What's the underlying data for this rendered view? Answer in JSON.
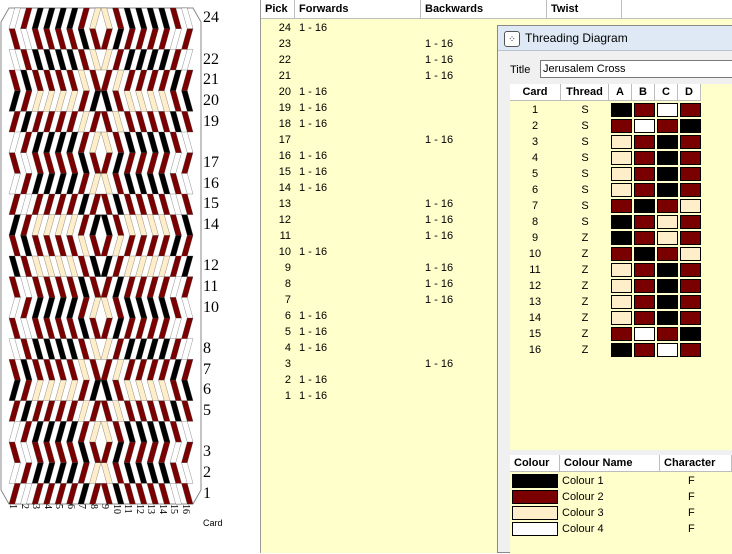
{
  "pattern": {
    "row_labels": [
      "24",
      "22",
      "21",
      "20",
      "19",
      "17",
      "16",
      "15",
      "14",
      "12",
      "11",
      "10",
      "8",
      "7",
      "6",
      "5",
      "3",
      "2",
      "1"
    ],
    "row_label_picks": [
      24,
      22,
      21,
      20,
      19,
      17,
      16,
      15,
      14,
      12,
      11,
      10,
      8,
      7,
      6,
      5,
      3,
      2,
      1
    ],
    "col_labels": [
      "1",
      "2",
      "3",
      "4",
      "5",
      "6",
      "7",
      "8",
      "9",
      "10",
      "11",
      "12",
      "13",
      "14",
      "15",
      "16"
    ],
    "card_label": "Card"
  },
  "picks": {
    "headers": {
      "pick": "Pick",
      "forwards": "Forwards",
      "backwards": "Backwards",
      "twist": "Twist"
    },
    "rows": [
      {
        "pick": "24",
        "fwd": "1 - 16",
        "bwd": ""
      },
      {
        "pick": "23",
        "fwd": "",
        "bwd": "1 - 16"
      },
      {
        "pick": "22",
        "fwd": "",
        "bwd": "1 - 16"
      },
      {
        "pick": "21",
        "fwd": "",
        "bwd": "1 - 16"
      },
      {
        "pick": "20",
        "fwd": "1 - 16",
        "bwd": ""
      },
      {
        "pick": "19",
        "fwd": "1 - 16",
        "bwd": ""
      },
      {
        "pick": "18",
        "fwd": "1 - 16",
        "bwd": ""
      },
      {
        "pick": "17",
        "fwd": "",
        "bwd": "1 - 16"
      },
      {
        "pick": "16",
        "fwd": "1 - 16",
        "bwd": ""
      },
      {
        "pick": "15",
        "fwd": "1 - 16",
        "bwd": ""
      },
      {
        "pick": "14",
        "fwd": "1 - 16",
        "bwd": ""
      },
      {
        "pick": "13",
        "fwd": "",
        "bwd": "1 - 16"
      },
      {
        "pick": "12",
        "fwd": "",
        "bwd": "1 - 16"
      },
      {
        "pick": "11",
        "fwd": "",
        "bwd": "1 - 16"
      },
      {
        "pick": "10",
        "fwd": "1 - 16",
        "bwd": ""
      },
      {
        "pick": "9",
        "fwd": "",
        "bwd": "1 - 16"
      },
      {
        "pick": "8",
        "fwd": "",
        "bwd": "1 - 16"
      },
      {
        "pick": "7",
        "fwd": "",
        "bwd": "1 - 16"
      },
      {
        "pick": "6",
        "fwd": "1 - 16",
        "bwd": ""
      },
      {
        "pick": "5",
        "fwd": "1 - 16",
        "bwd": ""
      },
      {
        "pick": "4",
        "fwd": "1 - 16",
        "bwd": ""
      },
      {
        "pick": "3",
        "fwd": "",
        "bwd": "1 - 16"
      },
      {
        "pick": "2",
        "fwd": "1 - 16",
        "bwd": ""
      },
      {
        "pick": "1",
        "fwd": "1 - 16",
        "bwd": ""
      }
    ]
  },
  "threading": {
    "window_title": "Threading Diagram",
    "title_label": "Title",
    "title_value": "Jerusalem Cross",
    "headers": {
      "card": "Card",
      "thread": "Thread",
      "a": "A",
      "b": "B",
      "c": "C",
      "d": "D"
    },
    "cards": [
      {
        "card": "1",
        "thread": "S",
        "holes": [
          1,
          2,
          4,
          2
        ]
      },
      {
        "card": "2",
        "thread": "S",
        "holes": [
          2,
          4,
          2,
          1
        ]
      },
      {
        "card": "3",
        "thread": "S",
        "holes": [
          3,
          2,
          1,
          2
        ]
      },
      {
        "card": "4",
        "thread": "S",
        "holes": [
          3,
          2,
          1,
          2
        ]
      },
      {
        "card": "5",
        "thread": "S",
        "holes": [
          3,
          2,
          1,
          2
        ]
      },
      {
        "card": "6",
        "thread": "S",
        "holes": [
          3,
          2,
          1,
          2
        ]
      },
      {
        "card": "7",
        "thread": "S",
        "holes": [
          2,
          1,
          2,
          3
        ]
      },
      {
        "card": "8",
        "thread": "S",
        "holes": [
          1,
          2,
          3,
          2
        ]
      },
      {
        "card": "9",
        "thread": "Z",
        "holes": [
          1,
          2,
          3,
          2
        ]
      },
      {
        "card": "10",
        "thread": "Z",
        "holes": [
          2,
          1,
          2,
          3
        ]
      },
      {
        "card": "11",
        "thread": "Z",
        "holes": [
          3,
          2,
          1,
          2
        ]
      },
      {
        "card": "12",
        "thread": "Z",
        "holes": [
          3,
          2,
          1,
          2
        ]
      },
      {
        "card": "13",
        "thread": "Z",
        "holes": [
          3,
          2,
          1,
          2
        ]
      },
      {
        "card": "14",
        "thread": "Z",
        "holes": [
          3,
          2,
          1,
          2
        ]
      },
      {
        "card": "15",
        "thread": "Z",
        "holes": [
          2,
          4,
          2,
          1
        ]
      },
      {
        "card": "16",
        "thread": "Z",
        "holes": [
          1,
          2,
          4,
          2
        ]
      }
    ],
    "colour_headers": {
      "colour": "Colour",
      "name": "Colour Name",
      "character": "Character"
    },
    "colours": [
      {
        "hex": "#000000",
        "name": "Colour 1",
        "character": "F"
      },
      {
        "hex": "#7a0000",
        "name": "Colour 2",
        "character": "F"
      },
      {
        "hex": "#ffeec9",
        "name": "Colour 3",
        "character": "F"
      },
      {
        "hex": "#ffffff",
        "name": "Colour 4",
        "character": "F"
      }
    ]
  }
}
